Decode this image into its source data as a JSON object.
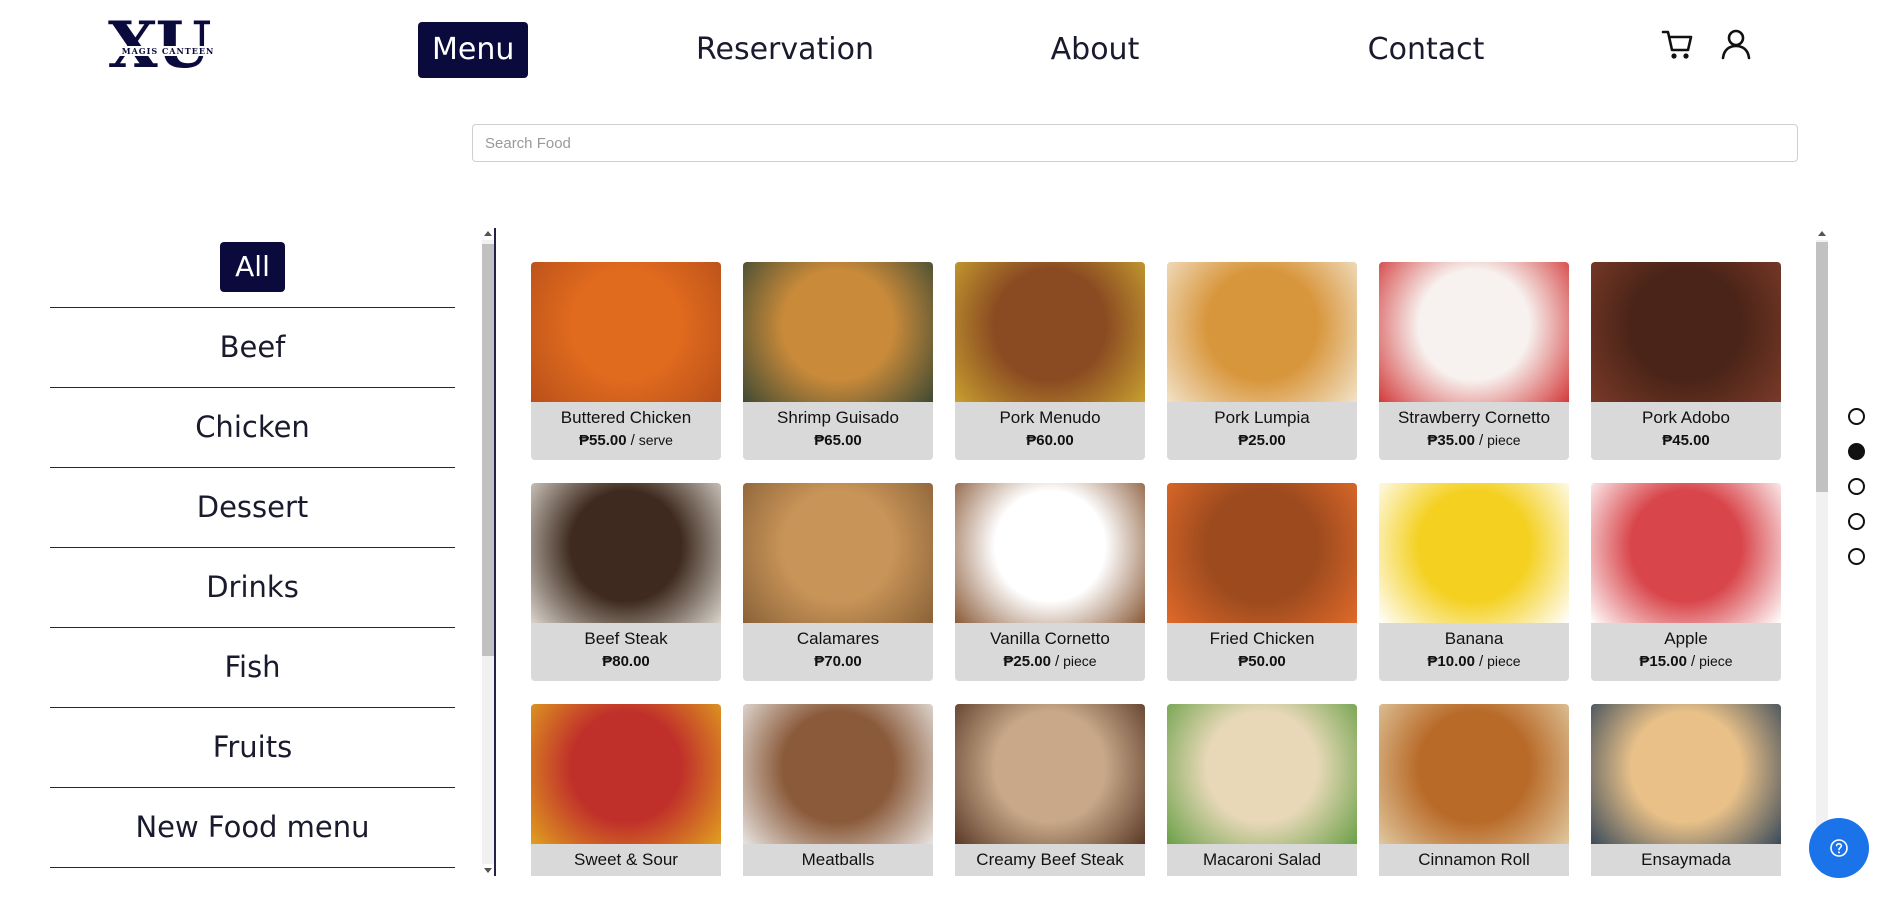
{
  "header": {
    "logo_text": "XU",
    "logo_subtext": "MAGIS CANTEEN",
    "nav": [
      {
        "label": "Menu",
        "active": true
      },
      {
        "label": "Reservation",
        "active": false
      },
      {
        "label": "About",
        "active": false
      },
      {
        "label": "Contact",
        "active": false
      }
    ],
    "cart_icon": "cart-icon",
    "user_icon": "user-icon"
  },
  "search": {
    "placeholder": "Search Food",
    "value": ""
  },
  "categories": [
    {
      "label": "All",
      "active": true
    },
    {
      "label": "Beef"
    },
    {
      "label": "Chicken"
    },
    {
      "label": "Dessert"
    },
    {
      "label": "Drinks"
    },
    {
      "label": "Fish"
    },
    {
      "label": "Fruits"
    },
    {
      "label": "New Food menu"
    }
  ],
  "foods": [
    {
      "name": "Buttered Chicken",
      "price": "₱55.00",
      "sep": "/",
      "unit": "serve",
      "colors": [
        "#e06a1e",
        "#b8501a"
      ]
    },
    {
      "name": "Shrimp Guisado",
      "price": "₱65.00",
      "colors": [
        "#c98a3a",
        "#3f4a33"
      ]
    },
    {
      "name": "Pork Menudo",
      "price": "₱60.00",
      "colors": [
        "#8a4a22",
        "#c8a030"
      ]
    },
    {
      "name": "Pork Lumpia",
      "price": "₱25.00",
      "colors": [
        "#d8963c",
        "#f2e2c8"
      ]
    },
    {
      "name": "Strawberry Cornetto",
      "price": "₱35.00",
      "sep": "/",
      "unit": "piece",
      "colors": [
        "#f7f2ef",
        "#d23a3a"
      ]
    },
    {
      "name": "Pork Adobo",
      "price": "₱45.00",
      "colors": [
        "#4a2418",
        "#7a3a28"
      ]
    },
    {
      "name": "Beef Steak",
      "price": "₱80.00",
      "colors": [
        "#3e2a1e",
        "#d9d4cc"
      ]
    },
    {
      "name": "Calamares",
      "price": "₱70.00",
      "colors": [
        "#c89458",
        "#8a6238"
      ]
    },
    {
      "name": "Vanilla Cornetto",
      "price": "₱25.00",
      "sep": "/",
      "unit": "piece",
      "colors": [
        "#ffffff",
        "#8a5a38"
      ]
    },
    {
      "name": "Fried Chicken",
      "price": "₱50.00",
      "colors": [
        "#9c4a1e",
        "#e06a2a"
      ]
    },
    {
      "name": "Banana",
      "price": "₱10.00",
      "sep": "/",
      "unit": "piece",
      "colors": [
        "#f4d020",
        "#ffffff"
      ]
    },
    {
      "name": "Apple",
      "price": "₱15.00",
      "sep": "/",
      "unit": "piece",
      "colors": [
        "#d8454a",
        "#ffffff"
      ]
    },
    {
      "name": "Sweet & Sour",
      "price": "",
      "colors": [
        "#c0302a",
        "#e0a020"
      ]
    },
    {
      "name": "Meatballs",
      "price": "",
      "colors": [
        "#8a5a3a",
        "#e8e4e0"
      ]
    },
    {
      "name": "Creamy Beef Steak",
      "price": "",
      "colors": [
        "#c8a888",
        "#5a3a28"
      ]
    },
    {
      "name": "Macaroni Salad",
      "price": "",
      "colors": [
        "#e8d8b8",
        "#6aa048"
      ]
    },
    {
      "name": "Cinnamon Roll",
      "price": "",
      "colors": [
        "#b86a28",
        "#e0c8a0"
      ]
    },
    {
      "name": "Ensaymada",
      "price": "",
      "colors": [
        "#e8c088",
        "#3a4a5a"
      ]
    }
  ],
  "pager": {
    "count": 5,
    "active_index": 1
  },
  "help_icon": "question-circle-icon"
}
